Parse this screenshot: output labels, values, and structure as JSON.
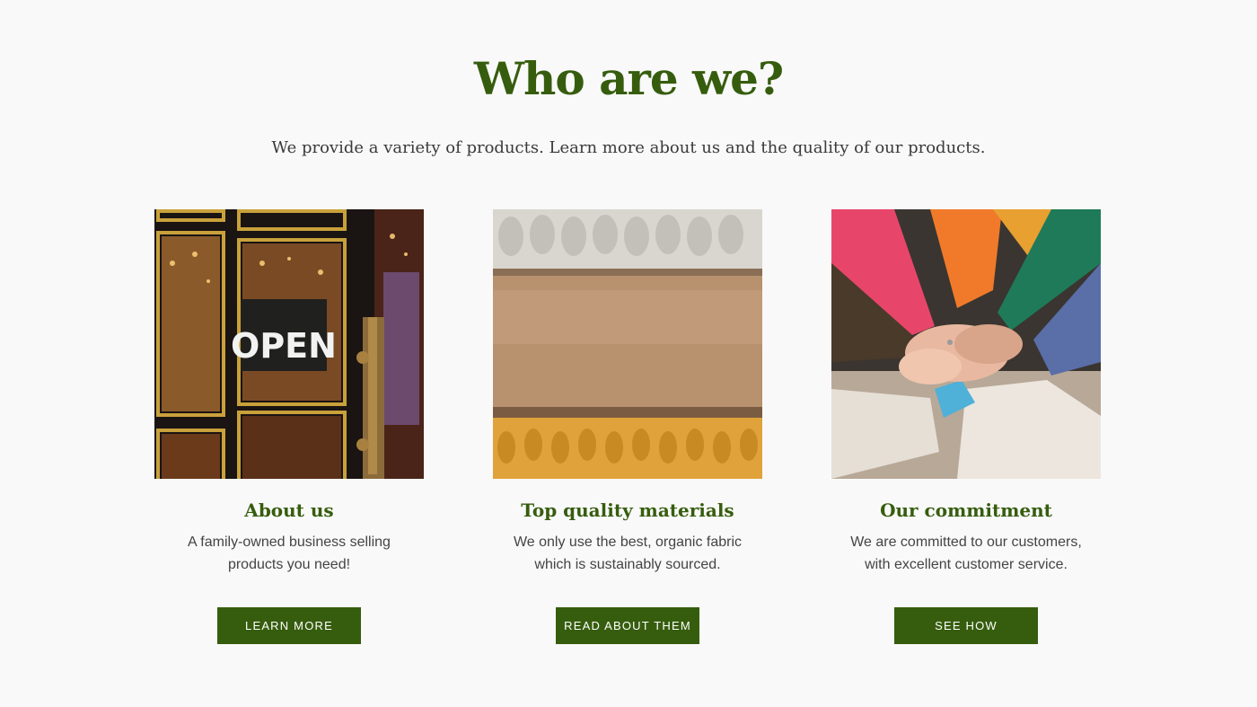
{
  "section": {
    "heading": "Who are we?",
    "subheading": "We provide a variety of products. Learn more about us and the quality of our products."
  },
  "columns": [
    {
      "image": "shop-door-open-sign-photo",
      "sign_text": "OPEN",
      "title": "About us",
      "text": "A family-owned business selling products you need!",
      "button": "LEARN MORE"
    },
    {
      "image": "folded-knit-fabrics-photo",
      "title": "Top quality materials",
      "text": "We only use the best, organic fabric which is sustainably sourced.",
      "button": "READ ABOUT THEM"
    },
    {
      "image": "stacked-hands-sweaters-photo",
      "title": "Our commitment",
      "text": "We are committed to our customers, with excellent customer service.",
      "button": "SEE HOW"
    }
  ],
  "colors": {
    "accent": "#365d0e",
    "background": "#f9f9f9",
    "body_text": "#444444"
  }
}
